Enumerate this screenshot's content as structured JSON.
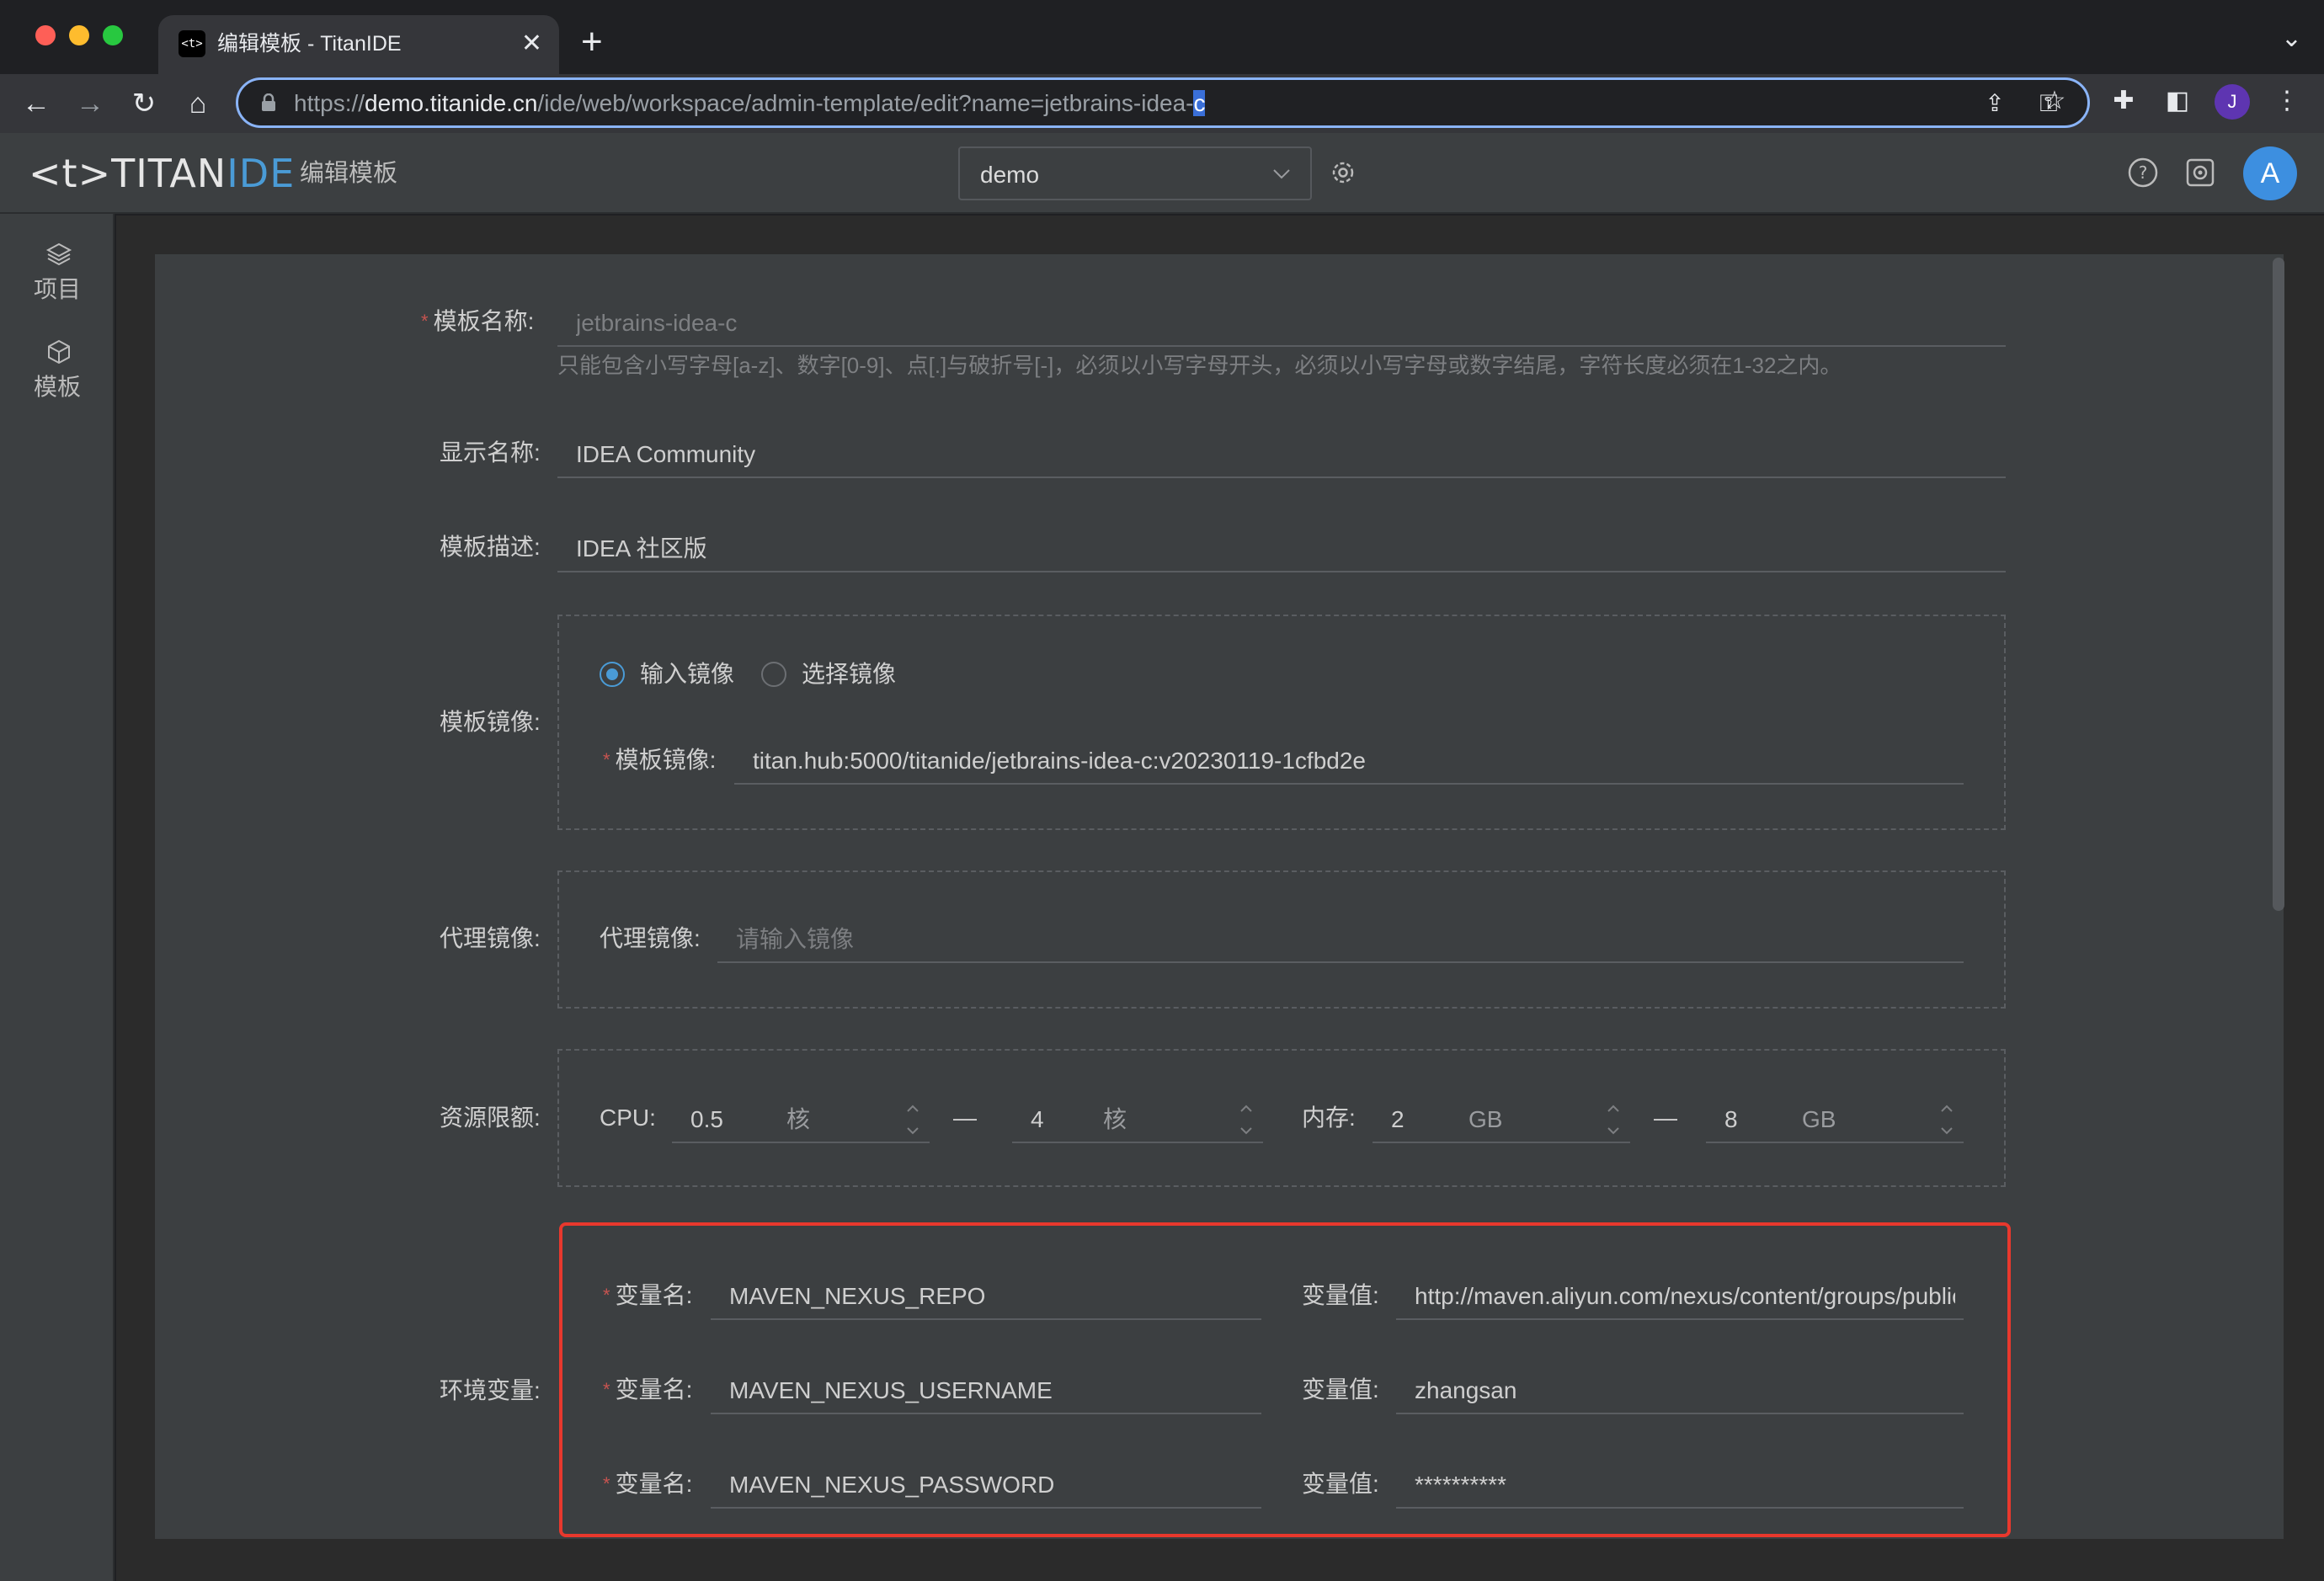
{
  "browser": {
    "tab_title": "编辑模板 - TitanIDE",
    "tab_favicon": "<t>",
    "url_scheme": "https://",
    "url_host": "demo.titanide.cn",
    "url_path": "/ide/web/workspace/admin-template/edit?name=jetbrains-idea-",
    "url_selected": "c",
    "profile_initial": "J"
  },
  "header": {
    "logo_prefix": "<t>TITAN",
    "logo_accent": "IDE",
    "title": "编辑模板",
    "workspace": "demo",
    "avatar_initial": "A"
  },
  "sidebar": {
    "items": [
      {
        "label": "项目",
        "icon": "layers-icon"
      },
      {
        "label": "模板",
        "icon": "cube-icon"
      }
    ]
  },
  "form": {
    "template_name": {
      "label": "模板名称:",
      "value": "jetbrains-idea-c",
      "hint": "只能包含小写字母[a-z]、数字[0-9]、点[.]与破折号[-]，必须以小写字母开头，必须以小写字母或数字结尾，字符长度必须在1-32之内。"
    },
    "display_name": {
      "label": "显示名称:",
      "value": "IDEA Community"
    },
    "description": {
      "label": "模板描述:",
      "value": "IDEA 社区版"
    },
    "image": {
      "label": "模板镜像:",
      "radio_input": "输入镜像",
      "radio_select": "选择镜像",
      "selected": "输入镜像",
      "inner_label": "模板镜像:",
      "value": "titan.hub:5000/titanide/jetbrains-idea-c:v20230119-1cfbd2e"
    },
    "proxy_image": {
      "label": "代理镜像:",
      "inner_label": "代理镜像:",
      "placeholder": "请输入镜像"
    },
    "resources": {
      "label": "资源限额:",
      "cpu_label": "CPU:",
      "cpu_min": "0.5",
      "cpu_max": "4",
      "cpu_unit": "核",
      "mem_label": "内存:",
      "mem_min": "2",
      "mem_max": "8",
      "mem_unit": "GB",
      "range_sep": "—"
    },
    "env": {
      "label": "环境变量:",
      "name_label": "变量名:",
      "value_label": "变量值:",
      "highlight_color": "#e8382d",
      "vars": [
        {
          "name": "MAVEN_NEXUS_REPO",
          "value": "http://maven.aliyun.com/nexus/content/groups/public"
        },
        {
          "name": "MAVEN_NEXUS_USERNAME",
          "value": "zhangsan"
        },
        {
          "name": "MAVEN_NEXUS_PASSWORD",
          "value": "**********"
        }
      ]
    }
  },
  "colors": {
    "accent": "#4a9bd6",
    "required": "#c75450",
    "panel": "#3c3f41"
  }
}
